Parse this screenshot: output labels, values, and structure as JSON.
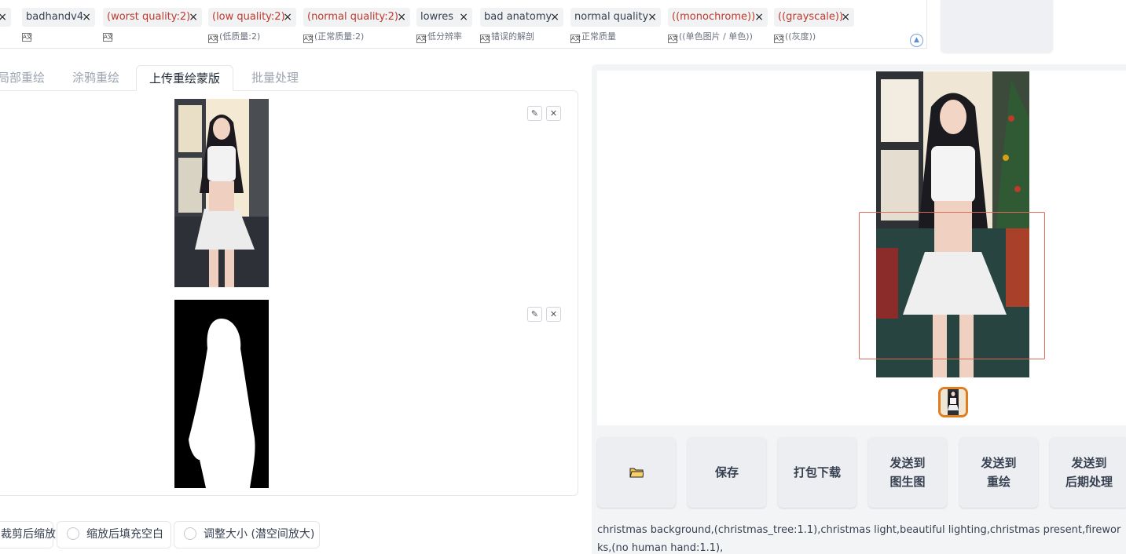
{
  "tags": [
    {
      "text": "badhandv4",
      "translation": "",
      "emphasized": false
    },
    {
      "text": "(worst quality:2)",
      "translation": "",
      "emphasized": true
    },
    {
      "text": "(low quality:2)",
      "translation": "(低质量:2)",
      "emphasized": true
    },
    {
      "text": "(normal quality:2)",
      "translation": "(正常质量:2)",
      "emphasized": true
    },
    {
      "text": "lowres",
      "translation": "低分辨率",
      "emphasized": false
    },
    {
      "text": "bad anatomy",
      "translation": "错误的解剖",
      "emphasized": false
    },
    {
      "text": "normal quality",
      "translation": "正常质量",
      "emphasized": false
    },
    {
      "text": "((monochrome))",
      "translation": "((单色图片 / 单色))",
      "emphasized": true
    },
    {
      "text": "((grayscale))",
      "translation": "((灰度))",
      "emphasized": true
    }
  ],
  "icons": {
    "remove": "×",
    "collapse": "chevron-up-icon",
    "edit": "pencil-icon",
    "close": "close-icon",
    "folder": "folder-icon",
    "translate": "translate-icon"
  },
  "tabs": [
    {
      "label": "局部重绘",
      "active": false
    },
    {
      "label": "涂鸦重绘",
      "active": false
    },
    {
      "label": "上传重绘蒙版",
      "active": true
    },
    {
      "label": "批量处理",
      "active": false
    }
  ],
  "resize_options": [
    {
      "label": "裁剪后缩放"
    },
    {
      "label": "缩放后填充空白"
    },
    {
      "label": "调整大小 (潜空间放大)"
    }
  ],
  "actions": [
    {
      "label": "",
      "icon": "folder-icon"
    },
    {
      "label": "保存"
    },
    {
      "label": "打包下载"
    },
    {
      "label": "发送到\n图生图"
    },
    {
      "label": "发送到\n重绘"
    },
    {
      "label": "发送到\n后期处理"
    }
  ],
  "prompt": "christmas background,(christmas_tree:1.1),christmas light,beautiful lighting,christmas present,fireworks,(no human hand:1.1),",
  "colors": {
    "accent_orange": "#e07d1f",
    "selection_red": "#dc6b5c",
    "emphasis_red": "#c0392b"
  }
}
